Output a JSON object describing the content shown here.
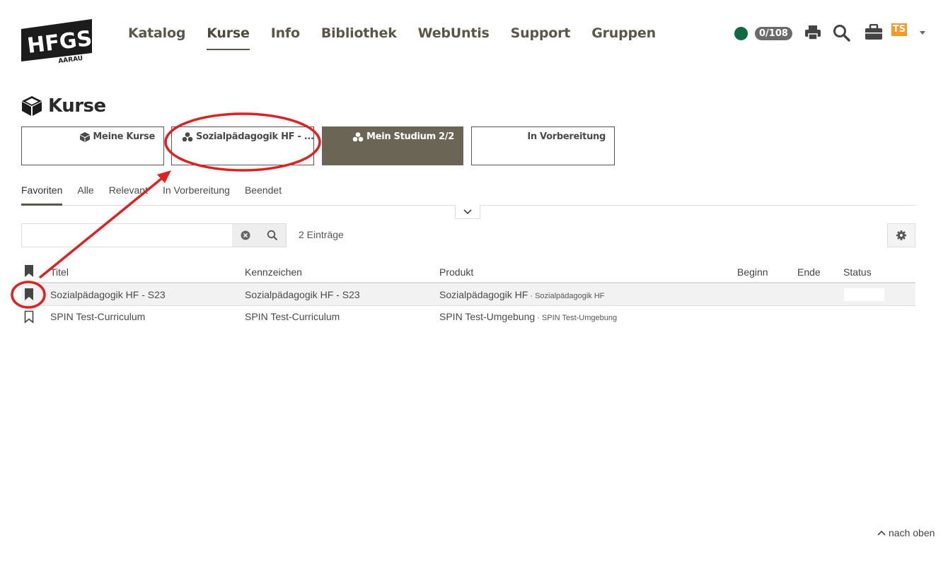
{
  "logo": {
    "main": "HFGS",
    "sub": "AARAU"
  },
  "nav": [
    "Katalog",
    "Kurse",
    "Info",
    "Bibliothek",
    "WebUntis",
    "Support",
    "Gruppen"
  ],
  "header": {
    "counter": "0/108",
    "user_initials": "TS",
    "status_color": "#0d6b3f",
    "badge_color": "#f39a2a"
  },
  "page": {
    "title": "Kurse"
  },
  "tiles": [
    {
      "label": "Meine Kurse",
      "icon": "cube-icon"
    },
    {
      "label": "Sozialpädagogik HF - ...",
      "icon": "cubes-icon"
    },
    {
      "label": "Mein Studium 2/2",
      "icon": "cubes-icon",
      "active": true
    },
    {
      "label": "In Vorbereitung"
    }
  ],
  "subtabs": [
    "Favoriten",
    "Alle",
    "Relevant",
    "In Vorbereitung",
    "Beendet"
  ],
  "search": {
    "value": "",
    "entries": "2 Einträge"
  },
  "table": {
    "headers": [
      "Titel",
      "Kennzeichen",
      "Produkt",
      "Beginn",
      "Ende",
      "Status"
    ],
    "rows": [
      {
        "favorite": true,
        "title": "Sozialpädagogik HF - S23",
        "code": "Sozialpädagogik HF - S23",
        "product": "Sozialpädagogik HF",
        "product_sub": "Sozialpädagogik HF",
        "begin": "",
        "end": "",
        "status": ""
      },
      {
        "favorite": false,
        "title": "SPIN Test-Curriculum",
        "code": "SPIN Test-Curriculum",
        "product": "SPIN Test-Umgebung",
        "product_sub": "SPIN Test-Umgebung",
        "begin": "",
        "end": "",
        "status": ""
      }
    ]
  },
  "footer": {
    "to_top": "nach oben"
  },
  "annotation_color": "#e02020"
}
